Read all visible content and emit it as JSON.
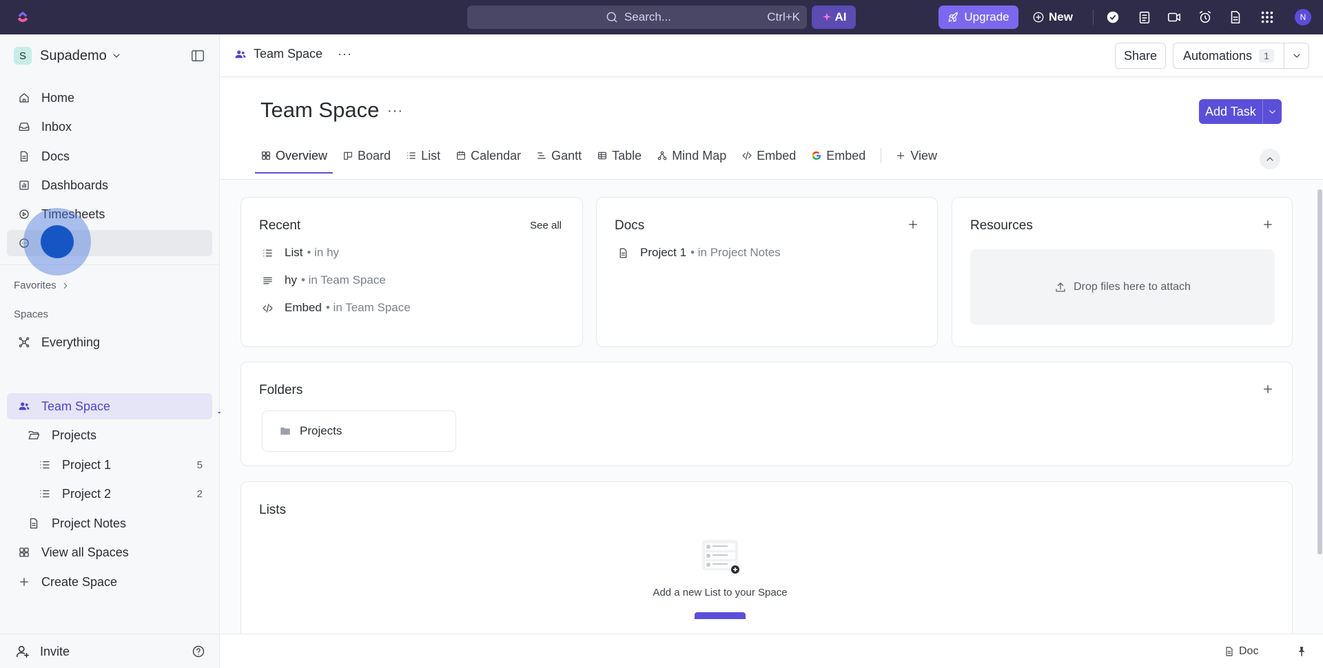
{
  "topbar": {
    "search_placeholder": "Search...",
    "search_shortcut": "Ctrl+K",
    "ai_label": "AI",
    "upgrade_label": "Upgrade",
    "new_label": "New",
    "avatar_initial": "N"
  },
  "sidebar": {
    "workspace_initial": "S",
    "workspace_name": "Supademo",
    "nav": [
      {
        "label": "Home",
        "icon": "home-icon"
      },
      {
        "label": "Inbox",
        "icon": "inbox-icon"
      },
      {
        "label": "Docs",
        "icon": "docs-icon"
      },
      {
        "label": "Dashboards",
        "icon": "dashboards-icon"
      },
      {
        "label": "Timesheets",
        "icon": "timesheets-icon"
      },
      {
        "label": "",
        "icon": "more-circle-icon"
      }
    ],
    "favorites_label": "Favorites",
    "spaces_label": "Spaces",
    "spaces": {
      "everything": "Everything",
      "team_space": "Team Space",
      "projects_folder": "Projects",
      "project1": {
        "label": "Project 1",
        "count": "5"
      },
      "project2": {
        "label": "Project 2",
        "count": "2"
      },
      "project_notes": "Project Notes",
      "view_all": "View all Spaces",
      "create": "Create Space"
    },
    "invite_label": "Invite"
  },
  "header": {
    "breadcrumb": "Team Space",
    "share_label": "Share",
    "automations_label": "Automations",
    "automations_count": "1"
  },
  "page": {
    "title": "Team Space",
    "add_task_label": "Add Task",
    "tabs": [
      {
        "label": "Overview",
        "icon": "overview-icon"
      },
      {
        "label": "Board",
        "icon": "board-icon"
      },
      {
        "label": "List",
        "icon": "list-icon"
      },
      {
        "label": "Calendar",
        "icon": "calendar-icon"
      },
      {
        "label": "Gantt",
        "icon": "gantt-icon"
      },
      {
        "label": "Table",
        "icon": "table-icon"
      },
      {
        "label": "Mind Map",
        "icon": "mindmap-icon"
      },
      {
        "label": "Embed",
        "icon": "embed-icon"
      },
      {
        "label": "Embed",
        "icon": "google-icon"
      },
      {
        "label": "View",
        "icon": "plus-icon"
      }
    ]
  },
  "recent": {
    "title": "Recent",
    "see_all": "See all",
    "items": [
      {
        "name": "List",
        "loc": "• in hy"
      },
      {
        "name": "hy",
        "loc": "• in Team Space"
      },
      {
        "name": "Embed",
        "loc": "• in Team Space"
      }
    ]
  },
  "docs": {
    "title": "Docs",
    "items": [
      {
        "name": "Project 1",
        "loc": "• in Project Notes"
      }
    ]
  },
  "resources": {
    "title": "Resources",
    "drop_text": "Drop files here to attach"
  },
  "folders": {
    "title": "Folders",
    "items": [
      {
        "name": "Projects"
      }
    ]
  },
  "lists": {
    "title": "Lists",
    "empty_text": "Add a new List to your Space"
  },
  "footer": {
    "doc_label": "Doc"
  }
}
